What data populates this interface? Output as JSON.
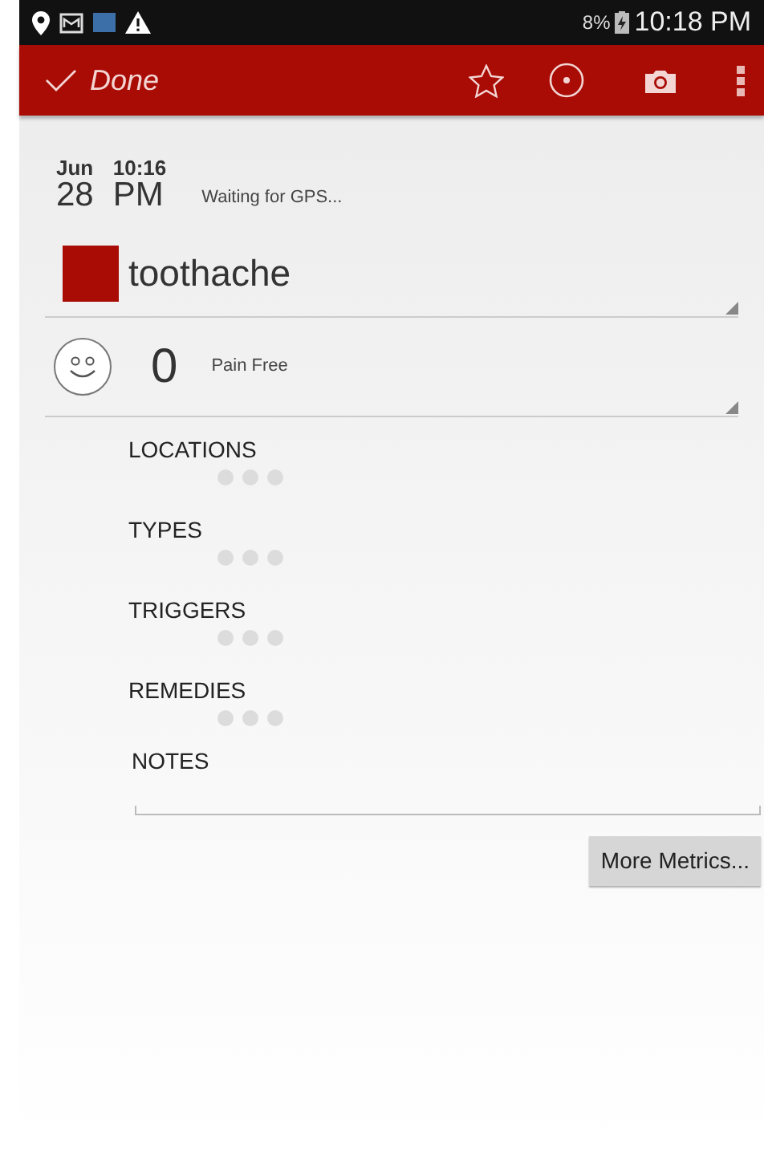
{
  "status_bar": {
    "battery": "8%",
    "time": "10:18 PM"
  },
  "action_bar": {
    "done": "Done"
  },
  "date": {
    "month": "Jun",
    "day": "28",
    "time": "10:16",
    "ampm": "PM",
    "gps": "Waiting for GPS..."
  },
  "condition": {
    "name": "toothache",
    "color": "#a80c04"
  },
  "pain": {
    "value": "0",
    "label": "Pain Free"
  },
  "sections": [
    {
      "label": "LOCATIONS",
      "kind": "loading"
    },
    {
      "label": "TYPES",
      "kind": "loading"
    },
    {
      "label": "TRIGGERS",
      "kind": "loading"
    },
    {
      "label": "REMEDIES",
      "kind": "loading"
    },
    {
      "label": "NOTES",
      "kind": "notes"
    }
  ],
  "more_button": "More Metrics..."
}
